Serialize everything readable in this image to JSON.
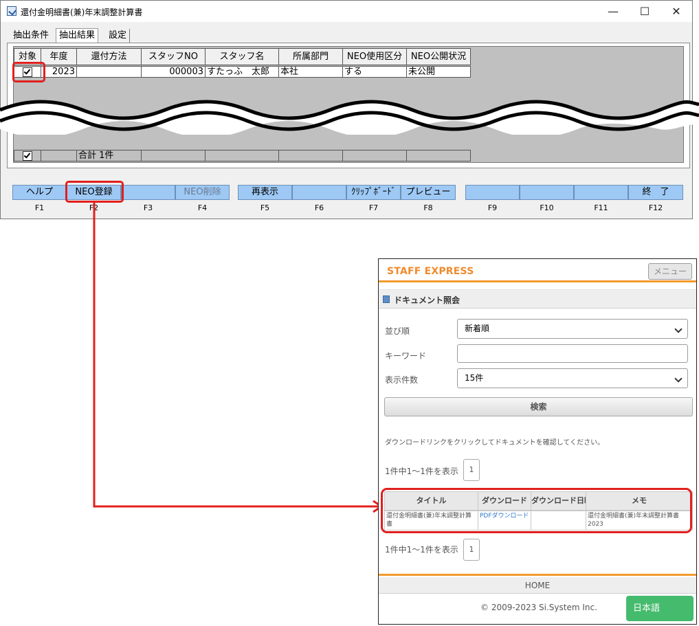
{
  "window": {
    "title": "還付金明細書(兼)年末調整計算書",
    "minimize": "—",
    "maximize": "☐",
    "close": "✕"
  },
  "tabs": [
    "抽出条件",
    "抽出結果",
    "設定"
  ],
  "grid": {
    "headers": [
      "対象",
      "年度",
      "還付方法",
      "スタッフNO",
      "スタッフ名",
      "所属部門",
      "NEO使用区分",
      "NEO公開状況"
    ],
    "row": {
      "checked": true,
      "year": "2023",
      "method": "",
      "staff_no": "000003",
      "staff_name": "すたっふ　太郎",
      "department": "本社",
      "neo_use": "する",
      "neo_status": "未公開"
    },
    "total_label": "合計 1件"
  },
  "fkeys": [
    {
      "key": "F1",
      "label": "ヘルプ"
    },
    {
      "key": "F2",
      "label": "NEO登録"
    },
    {
      "key": "F3",
      "label": ""
    },
    {
      "key": "F4",
      "label": "NEO削除"
    },
    {
      "key": "F5",
      "label": "再表示"
    },
    {
      "key": "F6",
      "label": ""
    },
    {
      "key": "F7",
      "label": "ｸﾘｯﾌﾟﾎﾞｰﾄﾞ"
    },
    {
      "key": "F8",
      "label": "プレビュー"
    },
    {
      "key": "F9",
      "label": ""
    },
    {
      "key": "F10",
      "label": ""
    },
    {
      "key": "F11",
      "label": ""
    },
    {
      "key": "F12",
      "label": "終　了"
    }
  ],
  "mobile": {
    "brand": "STAFF EXPRESS",
    "menu": "メニュー",
    "section_title": "ドキュメント照会",
    "sort_label": "並び順",
    "sort_value": "新着順",
    "keyword_label": "キーワード",
    "keyword_value": "",
    "count_label": "表示件数",
    "count_value": "15件",
    "search_button": "検索",
    "hint": "ダウンロードリンクをクリックしてドキュメントを確認してください。",
    "result_count": "1件中1～1件を表示",
    "page": "1",
    "table_headers": [
      "タイトル",
      "ダウンロード",
      "ダウンロード日時",
      "メモ"
    ],
    "table_row": {
      "title": "還付金明細書(兼)年末調整計算書",
      "download": "PDFダウンロード",
      "downloaded_at": "",
      "memo": "還付金明細書(兼)年末調整計算書2023"
    },
    "home": "HOME",
    "copyright": "© 2009-2023 Si.System Inc.",
    "language": "日本語"
  }
}
